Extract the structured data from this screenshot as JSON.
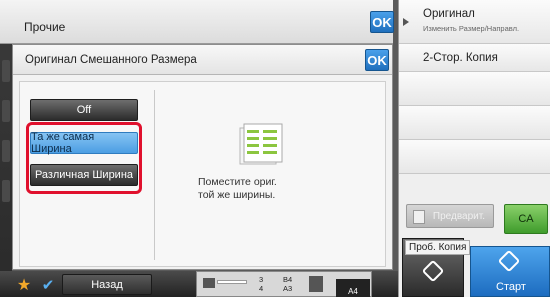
{
  "header": {
    "title": "Прочие",
    "ok_label": "OK"
  },
  "right_panel": {
    "original_title": "Оригинал",
    "original_subtitle": "Изменить Размер/Направл.",
    "duplex_label": "2-Стор. Копия",
    "preview_label": "Предварит.",
    "ca_label": "CA",
    "sample_copy_label": "Проб. Копия",
    "start_label": "Старт"
  },
  "dialog": {
    "title": "Оригинал Смешанного Размера",
    "ok_label": "OK",
    "options": [
      {
        "label": "Off",
        "state": "off"
      },
      {
        "label": "Та же самая Ширина",
        "state": "selected"
      },
      {
        "label": "Различная Ширина",
        "state": "unselected"
      }
    ],
    "description_line1": "Поместите ориг.",
    "description_line2": "той же ширины."
  },
  "bottom_bar": {
    "back_label": "Назад",
    "tray_numbers": [
      "3",
      "4"
    ],
    "tray_sizes": [
      "B4",
      "A3"
    ],
    "paper_size": "A4"
  },
  "colors": {
    "accent_blue": "#2f86d6",
    "highlight_red": "#e0102d",
    "ca_green": "#4aa535",
    "star_orange": "#f2a82a"
  }
}
